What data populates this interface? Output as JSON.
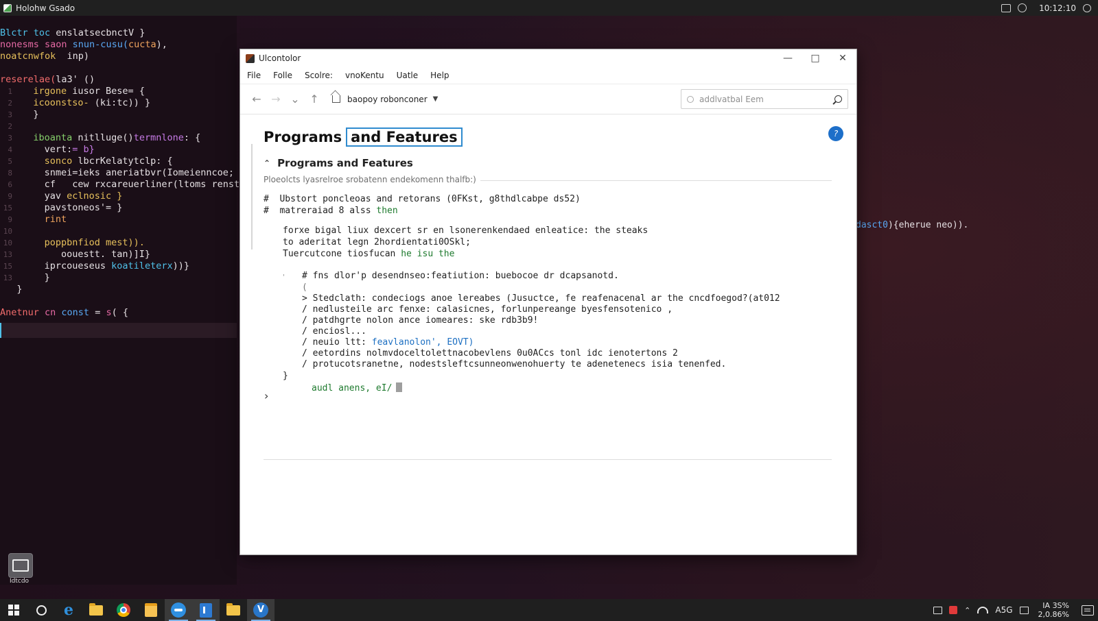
{
  "topbar": {
    "title": "Holohw Gsado",
    "clock": "10:12:10"
  },
  "editor": {
    "lines": [
      {
        "n": "",
        "parts": [
          {
            "t": "Blctr toc ",
            "c": "c-cyan"
          },
          {
            "t": "enslatsecbnctV",
            "c": "c-white"
          },
          {
            "t": " }",
            "c": "c-white"
          }
        ]
      },
      {
        "n": "",
        "parts": [
          {
            "t": "nonesms saon ",
            "c": "c-pink"
          },
          {
            "t": "snun-cusu(",
            "c": "c-blue"
          },
          {
            "t": "cucta",
            "c": "c-orange"
          },
          {
            "t": "),",
            "c": "c-white"
          }
        ]
      },
      {
        "n": "",
        "parts": [
          {
            "t": "noatcnwfok  ",
            "c": "c-yellow"
          },
          {
            "t": "inp)",
            "c": "c-white"
          }
        ]
      },
      {
        "n": "",
        "parts": [
          {
            "t": "",
            "c": "c-white"
          }
        ]
      },
      {
        "n": "",
        "parts": [
          {
            "t": "reserelae(",
            "c": "c-red"
          },
          {
            "t": "la3' ()",
            "c": "c-white"
          }
        ]
      },
      {
        "n": "1",
        "parts": [
          {
            "t": "   irgone ",
            "c": "c-yellow"
          },
          {
            "t": "iusor Bese= {",
            "c": "c-white"
          }
        ]
      },
      {
        "n": "2",
        "parts": [
          {
            "t": "   icoonstso- ",
            "c": "c-yellow"
          },
          {
            "t": "(ki:tc)) }",
            "c": "c-white"
          }
        ]
      },
      {
        "n": "3",
        "parts": [
          {
            "t": "   }",
            "c": "c-white"
          }
        ]
      },
      {
        "n": "2",
        "parts": [
          {
            "t": "",
            "c": "c-white"
          }
        ]
      },
      {
        "n": "3",
        "parts": [
          {
            "t": "   iboanta ",
            "c": "c-green"
          },
          {
            "t": "nitlluge()",
            "c": "c-white"
          },
          {
            "t": "termnlone",
            "c": "c-purple"
          },
          {
            "t": ": {",
            "c": "c-white"
          }
        ]
      },
      {
        "n": "4",
        "parts": [
          {
            "t": "     vert:",
            "c": "c-white"
          },
          {
            "t": "= b}",
            "c": "c-purple"
          }
        ]
      },
      {
        "n": "5",
        "parts": [
          {
            "t": "     sonco ",
            "c": "c-yellow"
          },
          {
            "t": "lbcrKelatytclp: {",
            "c": "c-white"
          }
        ]
      },
      {
        "n": "8",
        "parts": [
          {
            "t": "     snmei=ieks aneriatbvr(Iomeienncoe;",
            "c": "c-white"
          }
        ]
      },
      {
        "n": "6",
        "parts": [
          {
            "t": "     cf   ",
            "c": "c-white"
          },
          {
            "t": "cew rxcareuerliner(ltoms renste)s",
            "c": "c-white"
          }
        ]
      },
      {
        "n": "9",
        "parts": [
          {
            "t": "     yav ",
            "c": "c-white"
          },
          {
            "t": "eclnosic }",
            "c": "c-yellow"
          }
        ]
      },
      {
        "n": "15",
        "parts": [
          {
            "t": "     pavstoneos'= }",
            "c": "c-white"
          }
        ]
      },
      {
        "n": "9",
        "parts": [
          {
            "t": "     rint",
            "c": "c-orange"
          }
        ]
      },
      {
        "n": "10",
        "parts": [
          {
            "t": "",
            "c": "c-white"
          }
        ]
      },
      {
        "n": "10",
        "parts": [
          {
            "t": "     poppbnfiod mest)).",
            "c": "c-yellow"
          }
        ]
      },
      {
        "n": "13",
        "parts": [
          {
            "t": "        oouestt. tan)]I}",
            "c": "c-white"
          }
        ]
      },
      {
        "n": "15",
        "parts": [
          {
            "t": "     iprcoueseus ",
            "c": "c-white"
          },
          {
            "t": "koatileterx",
            "c": "c-cyan"
          },
          {
            "t": "))}",
            "c": "c-white"
          }
        ]
      },
      {
        "n": "13",
        "parts": [
          {
            "t": "     }",
            "c": "c-white"
          }
        ]
      },
      {
        "n": "",
        "parts": [
          {
            "t": "   }",
            "c": "c-white"
          }
        ]
      },
      {
        "n": "",
        "parts": [
          {
            "t": "",
            "c": "c-white"
          }
        ]
      },
      {
        "n": "",
        "parts": [
          {
            "t": "Anetnur ",
            "c": "c-red"
          },
          {
            "t": "cn ",
            "c": "c-pink"
          },
          {
            "t": "const",
            "c": "c-blue"
          },
          {
            "t": " = ",
            "c": "c-white"
          },
          {
            "t": "s",
            "c": "c-pink"
          },
          {
            "t": "( {",
            "c": "c-white"
          }
        ]
      }
    ],
    "right_code": [
      {
        "t": "dasct0",
        "c": "c-blue"
      },
      {
        "t": "){eherue neo)).",
        "c": "c-white"
      }
    ]
  },
  "desktop": {
    "icon_label": "Idtcdo"
  },
  "window": {
    "title": "Ulcontolor",
    "menu": [
      "File",
      "Folle",
      "Scolre:",
      "vnoKentu",
      "Uatle",
      "Help"
    ],
    "breadcrumb": "baopoy robonconer",
    "search_placeholder": "addlvatbal Eem",
    "page_title_a": "Programs",
    "page_title_b": "and Features",
    "section_title": "Programs and Features",
    "section_desc": "Ploeolcts lyasrelroe srobatenn endekomenn thalfb:)",
    "lines": {
      "h1": "#  Ubstort poncleoas and retorans (0FKst, g8thdlcabpe ds52)",
      "h2a": "#  matreraiad 8 alss ",
      "h2b": "then",
      "p1": "forxe bigal liux dexcert sr en lsonerenkendaed enleatice: the steaks",
      "p2": "to aderitat legn 2hordientati0OSkl;",
      "p3a": "Tuercutcone tiosfucan ",
      "p3b": "he isu the",
      "c1": "# fns dlor'p desendnseo:featiution: buebocoe dr dcapsanotd.",
      "c2": "(",
      "c3": "> Stedclath: condeciogs anoe lereabes (Jusuctce, fe reafenacenal ar the cncdfoegod?(at012",
      "c4": "/ nedlusteile arc fenxe: calasicnes, forlunpereange byesfensotenico ,",
      "c5": "/ patdhgrte nolon ance iomeares: ske rdb3b9!",
      "c6": "/ enciosl...",
      "c7a": "/ neuio ltt: ",
      "c7b": "feavlanolon', EOVT)",
      "c8": "/ eetordins nolmvdoceltolettnacobevlens 0u0ACcs tonl idc ienotertons 2",
      "c9": "/ protucotsranetne, nodestsleftcsunneonwenohuerty te adenetenecs isia tenenfed.",
      "close": "}",
      "prompt": "audl anens, eI/"
    }
  },
  "taskbar": {
    "lang": "A5G",
    "time_top": "IA 3S%",
    "time_bottom": "2,0.86%"
  }
}
